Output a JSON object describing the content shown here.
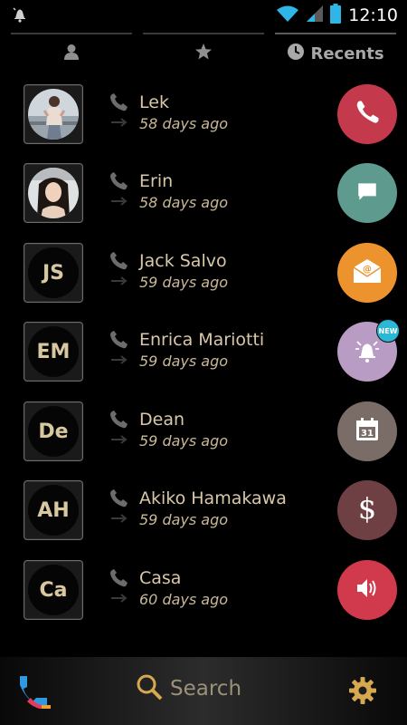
{
  "status_bar": {
    "time": "12:10",
    "icons": [
      "notification-bell-icon",
      "wifi-icon",
      "signal-icon",
      "battery-icon"
    ]
  },
  "tabs": [
    {
      "icon": "contacts-icon",
      "label": ""
    },
    {
      "icon": "favorites-star-icon",
      "label": ""
    },
    {
      "icon": "recents-clock-icon",
      "label": "Recents"
    }
  ],
  "calls": [
    {
      "name": "Lek",
      "time": "58 days ago",
      "avatar": "photo",
      "initials": "",
      "action": "call",
      "action_color": "#c43a4c"
    },
    {
      "name": "Erin",
      "time": "58 days ago",
      "avatar": "photo",
      "initials": "",
      "action": "message",
      "action_color": "#5f9a8e"
    },
    {
      "name": "Jack Salvo",
      "time": "59 days ago",
      "avatar": "initials",
      "initials": "JS",
      "action": "email",
      "action_color": "#ec932d"
    },
    {
      "name": "Enrica Mariotti",
      "time": "59 days ago",
      "avatar": "initials",
      "initials": "EM",
      "action": "reminder",
      "action_color": "#b99cc4",
      "badge": "NEW"
    },
    {
      "name": "Dean",
      "time": "59 days ago",
      "avatar": "initials",
      "initials": "De",
      "action": "calendar",
      "action_color": "#7a6c66"
    },
    {
      "name": "Akiko Hamakawa",
      "time": "59 days ago",
      "avatar": "initials",
      "initials": "AH",
      "action": "payment",
      "action_color": "#6e4044"
    },
    {
      "name": "Casa",
      "time": "60 days ago",
      "avatar": "initials",
      "initials": "Ca",
      "action": "speaker",
      "action_color": "#d03a4c"
    }
  ],
  "bottom_bar": {
    "search_label": "Search"
  }
}
